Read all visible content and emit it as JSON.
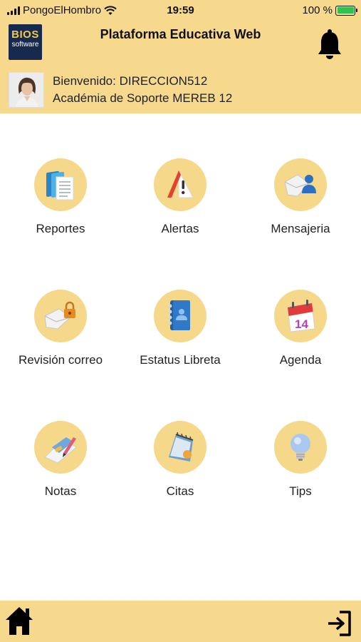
{
  "status_bar": {
    "carrier": "PongoElHombro",
    "time": "19:59",
    "battery": "100 %"
  },
  "header": {
    "logo_line1": "BIOS",
    "logo_line2": "software",
    "title": "Plataforma Educativa Web",
    "welcome": "Bienvenido: DIRECCION512",
    "school": "Académia de Soporte MEREB 12"
  },
  "menu": {
    "items": [
      {
        "label": "Reportes",
        "icon": "reports-icon"
      },
      {
        "label": "Alertas",
        "icon": "alert-icon"
      },
      {
        "label": "Mensajeria",
        "icon": "messaging-icon"
      },
      {
        "label": "Revisión correo",
        "icon": "mail-lock-icon"
      },
      {
        "label": "Estatus Libreta",
        "icon": "notebook-icon"
      },
      {
        "label": "Agenda",
        "icon": "calendar-icon"
      },
      {
        "label": "Notas",
        "icon": "notes-icon"
      },
      {
        "label": "Citas",
        "icon": "appointments-icon"
      },
      {
        "label": "Tips",
        "icon": "lightbulb-icon"
      }
    ]
  },
  "footer": {
    "home_icon": "home-icon",
    "exit_icon": "exit-icon"
  },
  "colors": {
    "bar_background": "#f7d98e",
    "tile_circle": "#f5d88a",
    "logo_background": "#162a4e"
  }
}
